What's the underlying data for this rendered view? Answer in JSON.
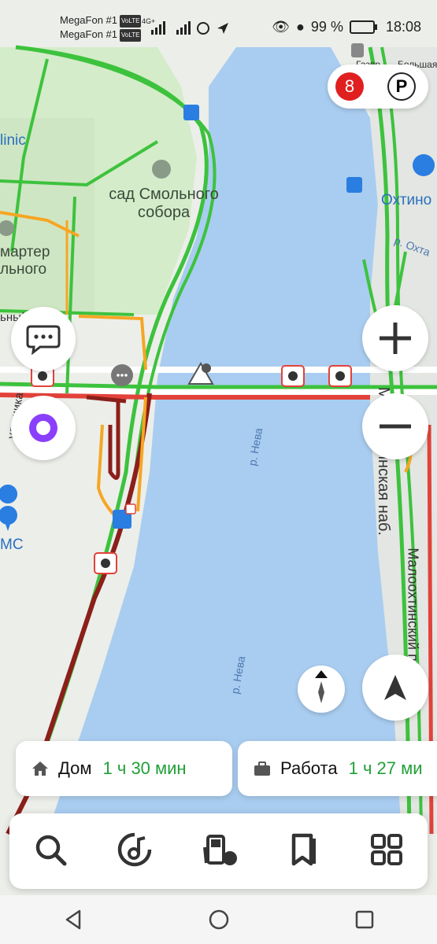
{
  "status_bar": {
    "carrier1": "MegaFon #1",
    "carrier2": "MegaFon #1",
    "network1": "VoLTE",
    "network2": "VoLTE",
    "gen": "4G+",
    "battery": "99 %",
    "time": "18:08"
  },
  "map": {
    "labels": {
      "garden_line1": "сад Смольного",
      "garden_line2": "собора",
      "clinic": "linic",
      "smartner1": "мартер",
      "smartner2": "льного",
      "prospekt": "ьный просп.",
      "okhta_district": "Охтино",
      "okhta_river": "р. Охта",
      "neva_1": "р. Нева",
      "neva_2": "р. Нева",
      "embankment": "Малоохтинская наб.",
      "embankment2": "Малоохтинский просп.",
      "street_left": "ульщика",
      "ms": "МС",
      "top_right1": "Газпр",
      "top_right2": "Большая"
    }
  },
  "traffic": {
    "score": "8"
  },
  "routes": [
    {
      "icon": "home-icon",
      "name": "Дом",
      "time": "1 ч 30 мин"
    },
    {
      "icon": "briefcase-icon",
      "name": "Работа",
      "time": "1 ч 27 ми"
    }
  ],
  "colors": {
    "water": "#a9cdf0",
    "jam_red": "#e2423a",
    "jam_dark": "#8b1f1a",
    "free_green": "#3dc23d",
    "slow_orange": "#f5a623",
    "route_time_green": "#21a038",
    "traffic_red": "#e02020",
    "alice_purple": "#8a3ffc"
  }
}
